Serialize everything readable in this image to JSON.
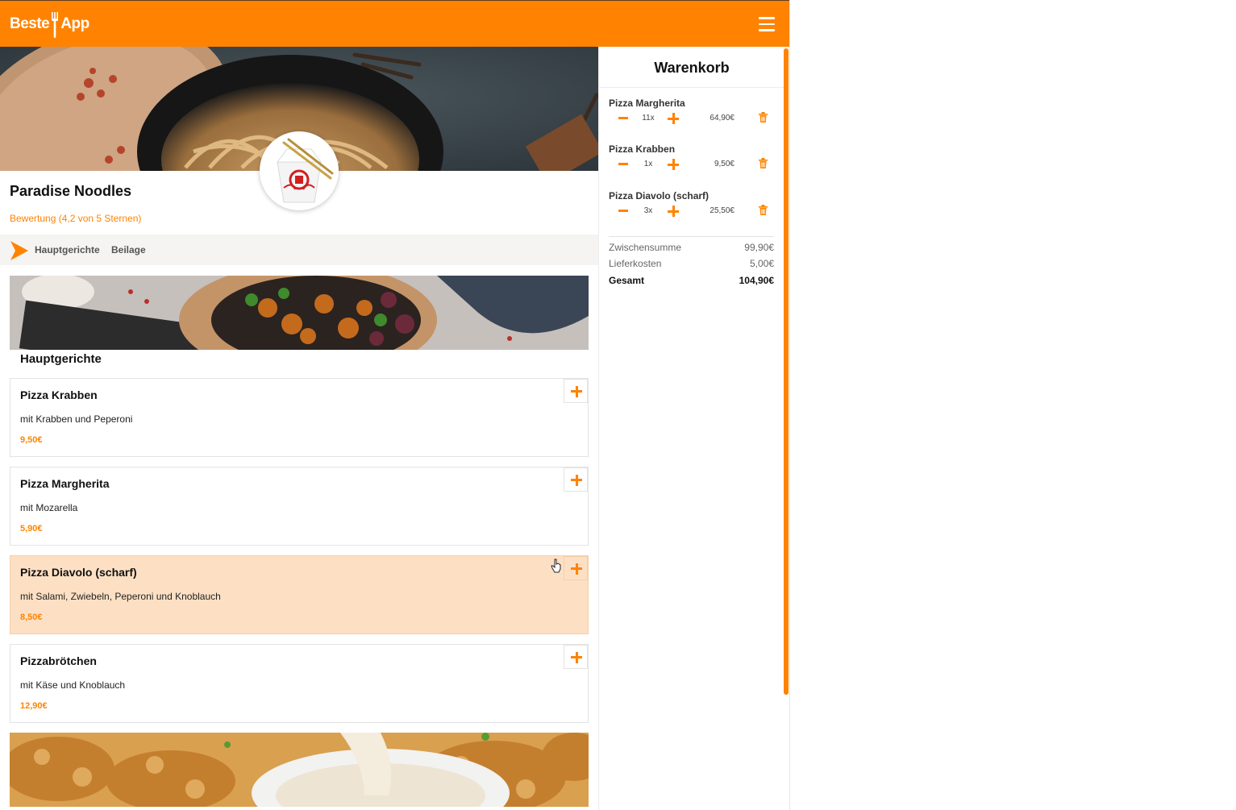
{
  "header": {
    "logo_left": "Beste",
    "logo_right": "App",
    "brand_color": "#ff8300"
  },
  "restaurant": {
    "name": "Paradise Noodles",
    "rating": "Bewertung (4,2 von 5 Sternen)"
  },
  "categories": [
    "Hauptgerichte",
    "Beilage"
  ],
  "section_title": "Hauptgerichte",
  "dishes": [
    {
      "name": "Pizza Krabben",
      "desc": "mit Krabben und Peperoni",
      "price": "9,50€"
    },
    {
      "name": "Pizza Margherita",
      "desc": "mit Mozarella",
      "price": "5,90€"
    },
    {
      "name": "Pizza Diavolo (scharf)",
      "desc": "mit Salami, Zwiebeln, Peperoni und Knoblauch",
      "price": "8,50€"
    },
    {
      "name": "Pizzabrötchen",
      "desc": "mit Käse und Knoblauch",
      "price": "12,90€"
    }
  ],
  "cart": {
    "title": "Warenkorb",
    "items": [
      {
        "name": "Pizza Margherita",
        "qty": "11x",
        "price": "64,90€"
      },
      {
        "name": "Pizza Krabben",
        "qty": "1x",
        "price": "9,50€"
      },
      {
        "name": "Pizza Diavolo (scharf)",
        "qty": "3x",
        "price": "25,50€"
      }
    ],
    "subtotal_label": "Zwischensumme",
    "subtotal": "99,90€",
    "delivery_label": "Lieferkosten",
    "delivery": "5,00€",
    "total_label": "Gesamt",
    "total": "104,90€"
  }
}
